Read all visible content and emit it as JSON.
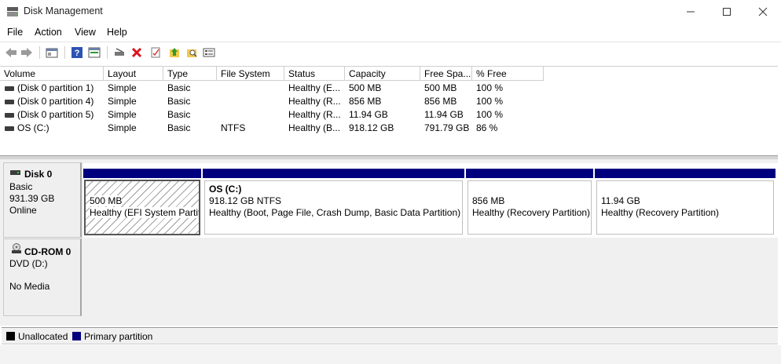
{
  "window": {
    "title": "Disk Management"
  },
  "menu": [
    "File",
    "Action",
    "View",
    "Help"
  ],
  "toolbar": [
    "back-icon",
    "forward-icon",
    "console-tree-icon",
    "help-icon",
    "properties-icon",
    "connect-icon",
    "delete-icon",
    "check-icon",
    "import-icon",
    "search-icon",
    "settings-icon"
  ],
  "columns": [
    "Volume",
    "Layout",
    "Type",
    "File System",
    "Status",
    "Capacity",
    "Free Spa...",
    "% Free"
  ],
  "volumes": [
    {
      "volume": "(Disk 0 partition 1)",
      "layout": "Simple",
      "type": "Basic",
      "fs": "",
      "status": "Healthy (E...",
      "capacity": "500 MB",
      "free": "500 MB",
      "pct": "100 %"
    },
    {
      "volume": "(Disk 0 partition 4)",
      "layout": "Simple",
      "type": "Basic",
      "fs": "",
      "status": "Healthy (R...",
      "capacity": "856 MB",
      "free": "856 MB",
      "pct": "100 %"
    },
    {
      "volume": "(Disk 0 partition 5)",
      "layout": "Simple",
      "type": "Basic",
      "fs": "",
      "status": "Healthy (R...",
      "capacity": "11.94 GB",
      "free": "11.94 GB",
      "pct": "100 %"
    },
    {
      "volume": "OS (C:)",
      "layout": "Simple",
      "type": "Basic",
      "fs": "NTFS",
      "status": "Healthy (B...",
      "capacity": "918.12 GB",
      "free": "791.79 GB",
      "pct": "86 %"
    }
  ],
  "disk0": {
    "name": "Disk 0",
    "type": "Basic",
    "size": "931.39 GB",
    "state": "Online"
  },
  "partitions": [
    {
      "label": "",
      "size": "500 MB",
      "status": "Healthy (EFI System Partit"
    },
    {
      "label": "OS  (C:)",
      "size": "918.12 GB NTFS",
      "status": "Healthy (Boot, Page File, Crash Dump, Basic Data Partition)"
    },
    {
      "label": "",
      "size": "856 MB",
      "status": "Healthy (Recovery Partition)"
    },
    {
      "label": "",
      "size": "11.94 GB",
      "status": "Healthy (Recovery Partition)"
    }
  ],
  "cdrom": {
    "name": "CD-ROM 0",
    "drive": "DVD (D:)",
    "media": "No Media"
  },
  "legend": {
    "unallocated": "Unallocated",
    "primary": "Primary partition",
    "unallocated_color": "#000000",
    "primary_color": "#00007f"
  }
}
